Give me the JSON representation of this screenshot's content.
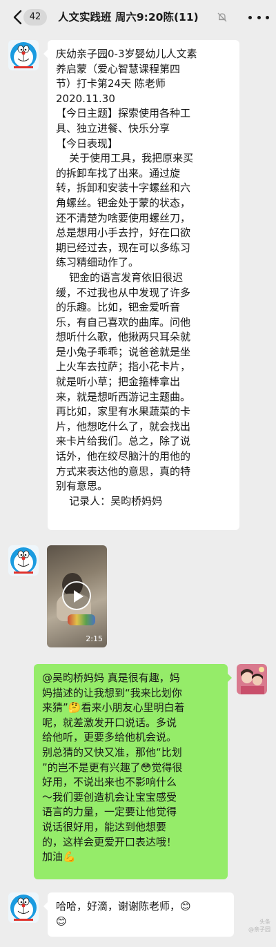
{
  "header": {
    "unread_count": "42",
    "title": "人文实践班 周六9:20陈(11)"
  },
  "messages": [
    {
      "sender": "left",
      "type": "text",
      "text": "庆幼亲子园0-3岁婴幼儿人文素\n养启蒙（爱心智慧课程第四\n节）打卡第24天 陈老师\n2020.11.30\n【今日主题】探索使用各种工\n具、独立进餐、快乐分享\n【今日表现】\n    关于使用工具，我把原来买\n的拆卸车找了出来。通过旋\n转，拆卸和安装十字螺丝和六\n角螺丝。钯金处于蒙的状态，\n还不清楚为啥要使用螺丝刀，\n总是想用小手去拧，好在口欲\n期已经过去，现在可以多练习\n练习精细动作了。\n    钯金的语言发育依旧很迟\n缓，不过我也从中发现了许多\n的乐趣。比如，钯金爱听音\n乐，有自己喜欢的曲库。问他\n想听什么歌，他揪两只耳朵就\n是小兔子乖乖；说爸爸就是坐\n上火车去拉萨；指小花卡片，\n就是听小草；把金箍棒拿出\n来，就是想听西游记主题曲。\n再比如，家里有水果蔬菜的卡\n片，他想吃什么了，就会找出\n来卡片给我们。总之，除了说\n话外，他在绞尽脑汁的用他的\n方式来表达他的意思，真的特\n别有意思。\n    记录人：吴昀桥妈妈"
    },
    {
      "sender": "left",
      "type": "video",
      "duration": "2:15"
    },
    {
      "sender": "right",
      "type": "text",
      "text": "@吴昀桥妈妈 真是很有趣，妈\n妈描述的让我想到“我来比划你\n来猜”🤔看来小朋友心里明白着\n呢，就差激发开口说话。多说\n给他听，更要多给他机会说。\n别总猜的又快又准，那他“比划\n”的岂不是更有兴趣了😳觉得很\n好用，不说出来也不影响什么\n～我们要创造机会让宝宝感受\n语言的力量，一定要让他觉得\n说话很好用，能达到他想要\n的，这样会更爱开口表达哦！\n加油💪"
    },
    {
      "sender": "left",
      "type": "text",
      "text": "哈哈，好滴，谢谢陈老师，😊\n😊"
    }
  ],
  "watermark": "头条\n@亲子园",
  "colors": {
    "background": "#ededed",
    "bubble_left": "#ffffff",
    "bubble_right": "#95ec69",
    "doraemon_blue": "#1a9be0"
  }
}
